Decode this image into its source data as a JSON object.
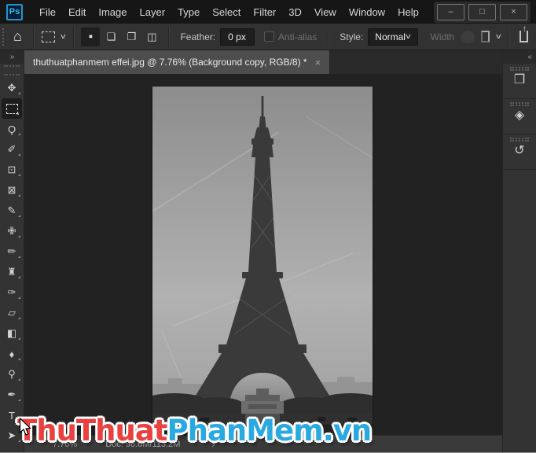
{
  "titlebar": {
    "logo": "Ps",
    "menus": [
      "File",
      "Edit",
      "Image",
      "Layer",
      "Type",
      "Select",
      "Filter",
      "3D",
      "View",
      "Window",
      "Help"
    ],
    "controls": [
      {
        "name": "minimize-button",
        "glyph": "–"
      },
      {
        "name": "maximize-button",
        "glyph": "□"
      },
      {
        "name": "close-button",
        "glyph": "×"
      }
    ]
  },
  "options_bar": {
    "home_icon": "⌂",
    "preset_chevron": "∨",
    "modes": [
      {
        "name": "new-selection-button",
        "glyph": "▪",
        "active": true
      },
      {
        "name": "add-to-selection-button",
        "glyph": "❏",
        "active": false
      },
      {
        "name": "subtract-from-selection-button",
        "glyph": "❐",
        "active": false
      },
      {
        "name": "intersect-selection-button",
        "glyph": "◫",
        "active": false
      }
    ],
    "feather_label": "Feather:",
    "feather_value": "0 px",
    "anti_alias_label": "Anti-alias",
    "style_label": "Style:",
    "style_value": "Normal",
    "style_chevron": "∨",
    "width_label": "Width",
    "mask_chevron": "∨",
    "share_arrow": "↑"
  },
  "tab_bar": {
    "left_collapse": "»",
    "right_collapse": "«",
    "tab": {
      "label": "thuthuatphanmem effei.jpg @ 7.76% (Background copy, RGB/8) *",
      "close": "×"
    }
  },
  "tools": [
    {
      "name": "move-tool",
      "glyph": "✥",
      "selected": false
    },
    {
      "name": "rectangular-marquee-tool",
      "glyph": "",
      "selected": true
    },
    {
      "name": "lasso-tool",
      "glyph": "Ϙ",
      "selected": false
    },
    {
      "name": "quick-selection-tool",
      "glyph": "✐",
      "selected": false
    },
    {
      "name": "crop-tool",
      "glyph": "⊡",
      "selected": false
    },
    {
      "name": "frame-tool",
      "glyph": "⊠",
      "selected": false
    },
    {
      "name": "eyedropper-tool",
      "glyph": "✎",
      "selected": false
    },
    {
      "name": "spot-healing-brush-tool",
      "glyph": "✙",
      "selected": false
    },
    {
      "name": "brush-tool",
      "glyph": "✏",
      "selected": false
    },
    {
      "name": "clone-stamp-tool",
      "glyph": "♜",
      "selected": false
    },
    {
      "name": "history-brush-tool",
      "glyph": "✑",
      "selected": false
    },
    {
      "name": "eraser-tool",
      "glyph": "▱",
      "selected": false
    },
    {
      "name": "paint-bucket-tool",
      "glyph": "◧",
      "selected": false
    },
    {
      "name": "blur-tool",
      "glyph": "♦",
      "selected": false
    },
    {
      "name": "dodge-tool",
      "glyph": "⚲",
      "selected": false
    },
    {
      "name": "pen-tool",
      "glyph": "✒",
      "selected": false
    },
    {
      "name": "type-tool",
      "glyph": "T",
      "selected": false
    },
    {
      "name": "path-selection-tool",
      "glyph": "➤",
      "selected": false
    }
  ],
  "right_dock": {
    "panels": [
      {
        "name": "libraries-panel-button",
        "glyph": "❒"
      },
      {
        "name": "layers-panel-button",
        "glyph": "◈"
      },
      {
        "name": "history-panel-button",
        "glyph": "↺"
      }
    ]
  },
  "status_bar": {
    "zoom": "7.76%",
    "doc": "Doc: 98.6M/113.2M",
    "flyout": "›"
  },
  "watermark": {
    "part_red": "ThuThuat",
    "part_blue": "PhanMem.vn",
    "red": "#e8413f",
    "blue": "#2aa9e0"
  },
  "canvas": {
    "image_name": "eiffel-tower-grayscale-photo"
  }
}
